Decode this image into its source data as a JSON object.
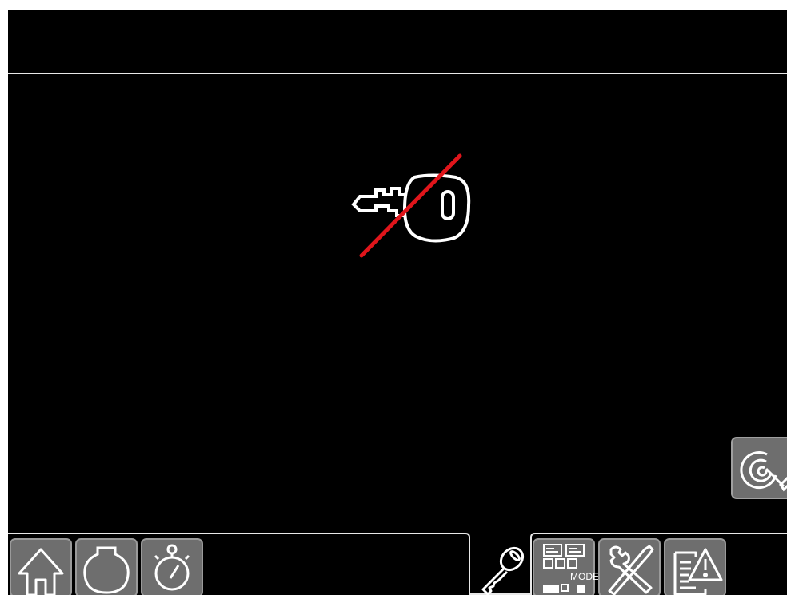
{
  "header": {
    "title": ""
  },
  "main": {
    "status_icon": "key-disabled-icon",
    "accent_color": "#e0151b"
  },
  "side": {
    "calibrate_icon": "target-wrench-icon"
  },
  "tabs": [
    {
      "icon": "home-icon"
    },
    {
      "icon": "drum-icon"
    },
    {
      "icon": "stopwatch-icon"
    },
    {
      "icon": "key-icon",
      "active": true
    },
    {
      "icon": "mode-icon",
      "label": "MODE"
    },
    {
      "icon": "tools-icon"
    },
    {
      "icon": "warning-report-icon"
    }
  ],
  "colors": {
    "tab_bg": "#6e6e6e",
    "tab_border": "#9a9a9a",
    "outline": "#e8e8e8"
  }
}
